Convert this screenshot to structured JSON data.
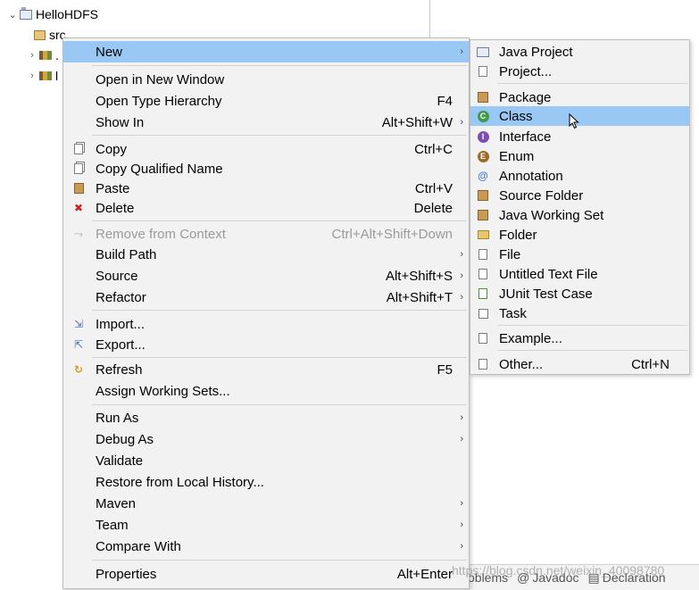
{
  "tree": {
    "project": "HelloHDFS",
    "src": "src",
    "row3": ".",
    "row4": "l"
  },
  "context_menu": {
    "items": [
      {
        "label": "New",
        "accel": "",
        "arrow": "›",
        "icon": ""
      },
      {
        "label": "Open in New Window",
        "accel": "",
        "arrow": "",
        "icon": ""
      },
      {
        "label": "Open Type Hierarchy",
        "accel": "F4",
        "arrow": "",
        "icon": ""
      },
      {
        "label": "Show In",
        "accel": "Alt+Shift+W",
        "arrow": "›",
        "icon": ""
      },
      {
        "label": "Copy",
        "accel": "Ctrl+C",
        "arrow": "",
        "icon": "copy-icon"
      },
      {
        "label": "Copy Qualified Name",
        "accel": "",
        "arrow": "",
        "icon": "copy-qualified-name-icon"
      },
      {
        "label": "Paste",
        "accel": "Ctrl+V",
        "arrow": "",
        "icon": "paste-icon"
      },
      {
        "label": "Delete",
        "accel": "Delete",
        "arrow": "",
        "icon": "delete-icon"
      },
      {
        "label": "Remove from Context",
        "accel": "Ctrl+Alt+Shift+Down",
        "arrow": "",
        "icon": "remove-context-icon"
      },
      {
        "label": "Build Path",
        "accel": "",
        "arrow": "›",
        "icon": ""
      },
      {
        "label": "Source",
        "accel": "Alt+Shift+S",
        "arrow": "›",
        "icon": ""
      },
      {
        "label": "Refactor",
        "accel": "Alt+Shift+T",
        "arrow": "›",
        "icon": ""
      },
      {
        "label": "Import...",
        "accel": "",
        "arrow": "",
        "icon": "import-icon"
      },
      {
        "label": "Export...",
        "accel": "",
        "arrow": "",
        "icon": "export-icon"
      },
      {
        "label": "Refresh",
        "accel": "F5",
        "arrow": "",
        "icon": "refresh-icon"
      },
      {
        "label": "Assign Working Sets...",
        "accel": "",
        "arrow": "",
        "icon": ""
      },
      {
        "label": "Run As",
        "accel": "",
        "arrow": "›",
        "icon": ""
      },
      {
        "label": "Debug As",
        "accel": "",
        "arrow": "›",
        "icon": ""
      },
      {
        "label": "Validate",
        "accel": "",
        "arrow": "",
        "icon": ""
      },
      {
        "label": "Restore from Local History...",
        "accel": "",
        "arrow": "",
        "icon": ""
      },
      {
        "label": "Maven",
        "accel": "",
        "arrow": "›",
        "icon": ""
      },
      {
        "label": "Team",
        "accel": "",
        "arrow": "›",
        "icon": ""
      },
      {
        "label": "Compare With",
        "accel": "",
        "arrow": "›",
        "icon": ""
      },
      {
        "label": "Properties",
        "accel": "Alt+Enter",
        "arrow": "",
        "icon": ""
      }
    ]
  },
  "new_submenu": {
    "items": [
      {
        "label": "Java Project",
        "accel": ""
      },
      {
        "label": "Project...",
        "accel": ""
      },
      {
        "label": "Package",
        "accel": ""
      },
      {
        "label": "Class",
        "accel": ""
      },
      {
        "label": "Interface",
        "accel": ""
      },
      {
        "label": "Enum",
        "accel": ""
      },
      {
        "label": "Annotation",
        "accel": ""
      },
      {
        "label": "Source Folder",
        "accel": ""
      },
      {
        "label": "Java Working Set",
        "accel": ""
      },
      {
        "label": "Folder",
        "accel": ""
      },
      {
        "label": "File",
        "accel": ""
      },
      {
        "label": "Untitled Text File",
        "accel": ""
      },
      {
        "label": "JUnit Test Case",
        "accel": ""
      },
      {
        "label": "Task",
        "accel": ""
      },
      {
        "label": "Example...",
        "accel": ""
      },
      {
        "label": "Other...",
        "accel": "Ctrl+N"
      }
    ],
    "icon_glyphs": {
      "class": "C",
      "interface": "I",
      "enum": "E",
      "annotation": "@"
    }
  },
  "bottom_tabs": {
    "problems": "oblems",
    "javadoc": "Javadoc",
    "declaration": "Declaration"
  },
  "watermark": "https://blog.csdn.net/weixin_40098780",
  "colors": {
    "menu_bg": "#f2f2f2",
    "highlight": "#99c8f5",
    "disabled_text": "#9a9a9a"
  }
}
